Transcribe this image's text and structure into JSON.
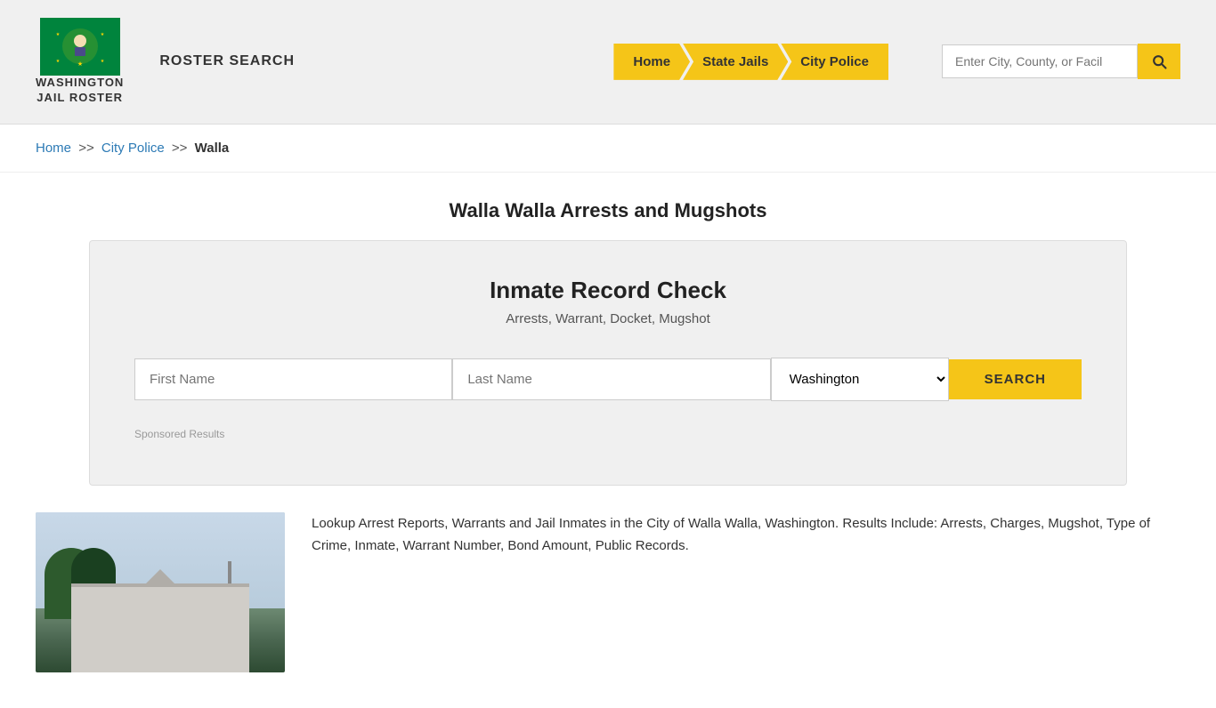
{
  "header": {
    "logo_line1": "WASHINGTON",
    "logo_line2": "JAIL ROSTER",
    "roster_search_label": "ROSTER SEARCH",
    "nav": {
      "home": "Home",
      "state_jails": "State Jails",
      "city_police": "City Police"
    },
    "search_placeholder": "Enter City, County, or Facil"
  },
  "breadcrumb": {
    "home": "Home",
    "separator1": ">>",
    "city_police": "City Police",
    "separator2": ">>",
    "current": "Walla"
  },
  "page_title": "Walla Walla Arrests and Mugshots",
  "inmate_check": {
    "title": "Inmate Record Check",
    "subtitle": "Arrests, Warrant, Docket, Mugshot",
    "first_name_placeholder": "First Name",
    "last_name_placeholder": "Last Name",
    "state_value": "Washington",
    "search_btn": "SEARCH",
    "sponsored_label": "Sponsored Results"
  },
  "description": {
    "text": "Lookup Arrest Reports, Warrants and Jail Inmates in the City of Walla Walla, Washington. Results Include: Arrests, Charges, Mugshot, Type of Crime, Inmate, Warrant Number, Bond Amount, Public Records."
  }
}
